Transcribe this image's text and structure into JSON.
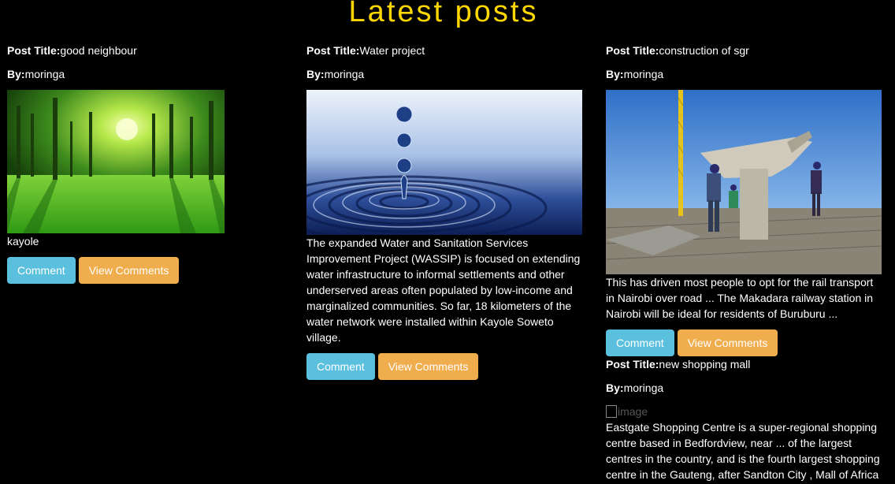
{
  "page": {
    "title": "Latest posts"
  },
  "labels": {
    "post_title": "Post Title:",
    "by": "By:"
  },
  "buttons": {
    "comment": "Comment",
    "view_comments": "View Comments"
  },
  "posts": [
    {
      "title": "good neighbour",
      "author": "moringa",
      "image": "forest-image",
      "body": "kayole"
    },
    {
      "title": "Water project",
      "author": "moringa",
      "image": "water-drop-image",
      "body": "The expanded Water and Sanitation Services Improvement Project (WASSIP) is focused on extending water infrastructure to informal settlements and other underserved areas often populated by low-income and marginalized communities. So far, 18 kilometers of the water network were installed within Kayole Soweto village."
    },
    {
      "title": "construction of sgr",
      "author": "moringa",
      "image": "railway-construction-image",
      "body": "This has driven most people to opt for the rail transport in Nairobi over road ... The Makadara railway station in Nairobi will be ideal for residents of Buruburu ..."
    },
    {
      "title": "new shopping mall",
      "author": "moringa",
      "image_alt": "image",
      "body": "Eastgate Shopping Centre is a super-regional shopping centre based in Bedfordview, near ... of the largest centres in the country, and is the fourth largest shopping centre in the Gauteng, after Sandton City , Mall of Africa"
    }
  ]
}
